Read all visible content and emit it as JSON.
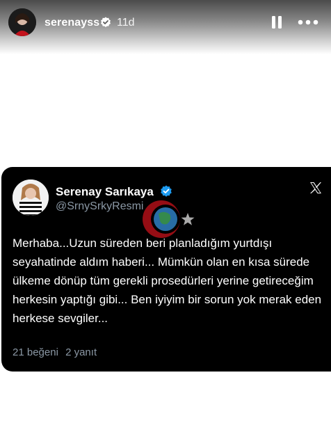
{
  "story": {
    "username": "serenayss",
    "time_ago": "11d",
    "icons": {
      "verified": "verified-badge-icon",
      "pause": "pause-icon",
      "more": "more-options-icon"
    }
  },
  "tweet": {
    "display_name": "Serenay Sarıkaya",
    "handle": "@SrnySrkyResmi",
    "text": "Merhaba...Uzun süreden beri planladığım yurtdışı seyahatinde aldım haberi... Mümkün olan en kısa sürede ülkeme dönüp tüm gerekli prosedürleri yerine getireceğim herkesin yaptığı gibi... Ben iyiyim bir sorun yok merak eden herkese sevgiler...",
    "likes": "21 beğeni",
    "replies": "2 yanıt",
    "colors": {
      "card_background": "#000000",
      "verified_blue": "#1d9bf0",
      "secondary_text": "#8b98a5"
    }
  }
}
